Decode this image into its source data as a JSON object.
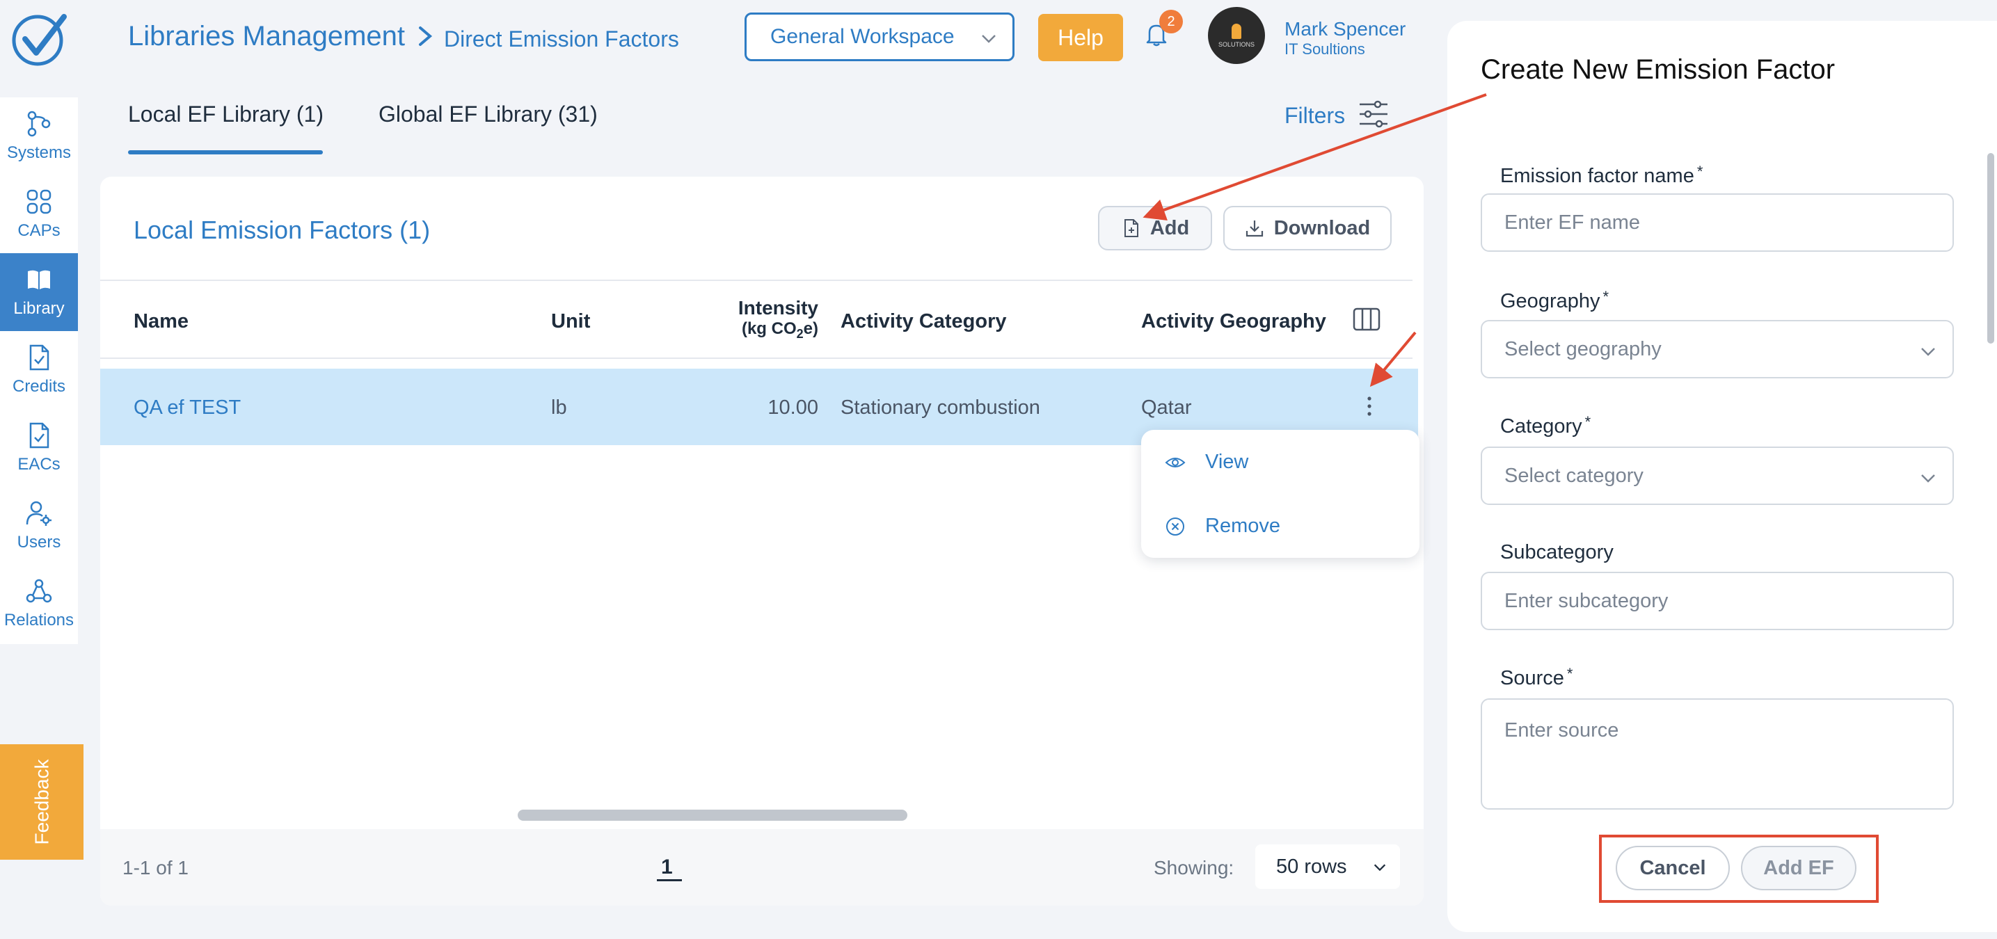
{
  "nav": {
    "items": [
      {
        "label": "Systems",
        "icon": "systems-icon",
        "active": false
      },
      {
        "label": "CAPs",
        "icon": "caps-icon",
        "active": false
      },
      {
        "label": "Library",
        "icon": "book-icon",
        "active": true
      },
      {
        "label": "Credits",
        "icon": "credits-icon",
        "active": false
      },
      {
        "label": "EACs",
        "icon": "eacs-icon",
        "active": false
      },
      {
        "label": "Users",
        "icon": "users-icon",
        "active": false
      },
      {
        "label": "Relations",
        "icon": "relations-icon",
        "active": false
      }
    ],
    "feedback_label": "Feedback"
  },
  "header": {
    "breadcrumb_root": "Libraries Management",
    "breadcrumb_leaf": "Direct Emission Factors",
    "workspace": "General Workspace",
    "help_label": "Help",
    "notification_count": "2",
    "avatar_text": "SOLUTIONS",
    "user_name": "Mark Spencer",
    "user_org": "IT Soultions"
  },
  "tabs": [
    {
      "label": "Local EF Library (1)",
      "active": true
    },
    {
      "label": "Global EF Library (31)",
      "active": false
    }
  ],
  "filters_label": "Filters",
  "card": {
    "title": "Local Emission Factors (1)",
    "add_label": "Add",
    "download_label": "Download"
  },
  "table": {
    "columns": {
      "name": "Name",
      "unit": "Unit",
      "intensity": "Intensity",
      "intensity_unit_prefix": "(kg CO",
      "intensity_unit_sub": "2",
      "intensity_unit_suffix": "e)",
      "activity_category": "Activity Category",
      "activity_geography": "Activity Geography"
    },
    "rows": [
      {
        "name": "QA ef TEST",
        "unit": "lb",
        "intensity": "10.00",
        "activity_category": "Stationary combustion",
        "activity_geography": "Qatar"
      }
    ]
  },
  "row_menu": {
    "view_label": "View",
    "remove_label": "Remove"
  },
  "pagination": {
    "range": "1-1 of 1",
    "current_page": "1",
    "showing_label": "Showing:",
    "rows_option": "50 rows"
  },
  "panel": {
    "title": "Create New Emission Factor",
    "fields": {
      "name_label": "Emission factor name",
      "name_placeholder": "Enter EF name",
      "geography_label": "Geography",
      "geography_placeholder": "Select geography",
      "category_label": "Category",
      "category_placeholder": "Select category",
      "subcategory_label": "Subcategory",
      "subcategory_placeholder": "Enter subcategory",
      "source_label": "Source",
      "source_placeholder": "Enter source",
      "required_mark": "*"
    },
    "cancel_label": "Cancel",
    "submit_label": "Add EF"
  },
  "colors": {
    "brand_blue": "#2e7cc4",
    "accent_orange": "#f2a93b",
    "row_highlight": "#cce7fa",
    "annotation_red": "#e04a33"
  }
}
